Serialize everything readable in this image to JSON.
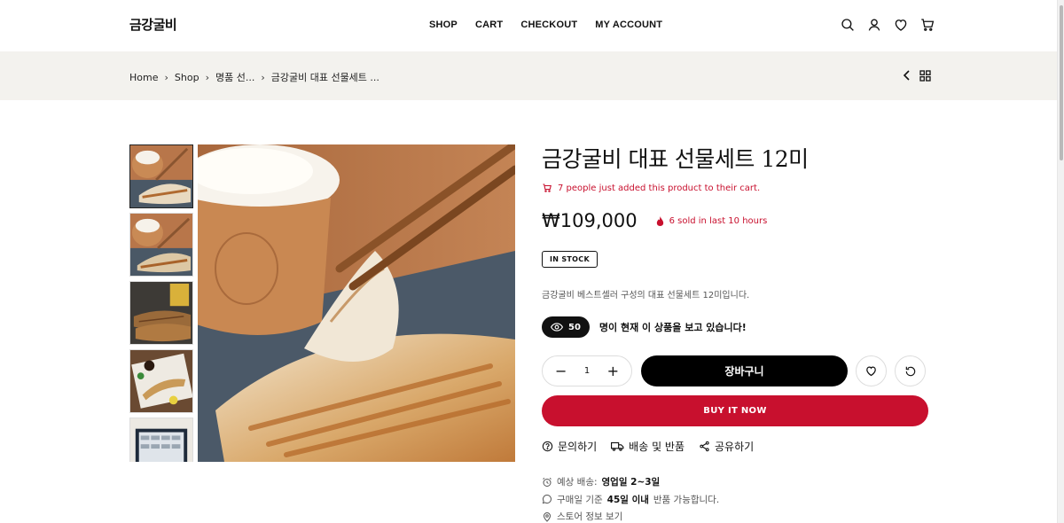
{
  "header": {
    "logo": "금강굴비",
    "nav": [
      "SHOP",
      "CART",
      "CHECKOUT",
      "MY ACCOUNT"
    ],
    "icons": [
      "search-icon",
      "user-icon",
      "heart-icon",
      "cart-icon"
    ]
  },
  "breadcrumb": {
    "items": [
      "Home",
      "Shop",
      "명품 선...",
      "금강굴비 대표 선물세트 ..."
    ]
  },
  "product": {
    "title": "금강굴비 대표 선물세트 12미",
    "added_text": "7 people just added this product to their cart.",
    "price": "₩109,000",
    "sold_text": "6 sold in last 10 hours",
    "stock": "IN STOCK",
    "description": "금강굴비 베스트셀러 구성의 대표 선물세트 12미입니다.",
    "viewers_count": "50",
    "viewers_text": "명이 현재 이 상품을 보고 있습니다!",
    "quantity": "1",
    "add_to_cart": "장바구니",
    "buy_now": "BUY IT NOW",
    "links": {
      "inquiry": "문의하기",
      "shipping": "배송 및 반품",
      "share": "공유하기"
    },
    "meta": {
      "delivery_label": "예상 배송:",
      "delivery_value": "영업일 2~3일",
      "return_prefix": "구매일 기준",
      "return_value": "45일 이내",
      "return_suffix": "반품 가능합니다.",
      "store_info": "스토어 정보 보기"
    }
  },
  "colors": {
    "accent_red": "#c8102e",
    "band_bg": "#f3f2ee",
    "text": "#111111"
  }
}
